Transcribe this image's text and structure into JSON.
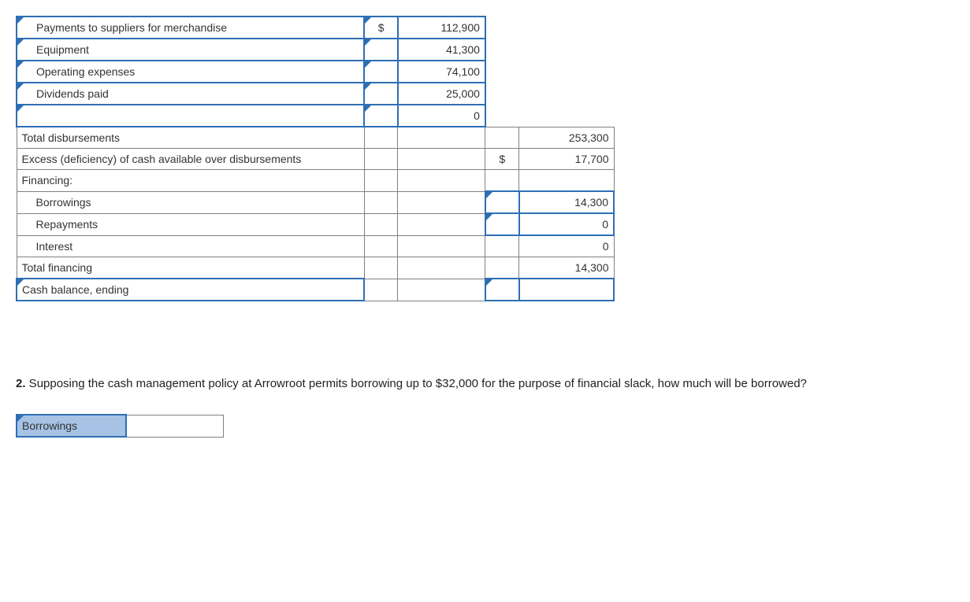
{
  "rows": {
    "payments_label": "Payments to suppliers for merchandise",
    "payments_sym": "$",
    "payments_val": "112,900",
    "equipment_label": "Equipment",
    "equipment_val": "41,300",
    "opex_label": "Operating expenses",
    "opex_val": "74,100",
    "dividends_label": "Dividends paid",
    "dividends_val": "25,000",
    "blank_val": "0",
    "total_disb_label": "Total disbursements",
    "total_disb_val": "253,300",
    "excess_label": "Excess (deficiency) of cash available over disbursements",
    "excess_sym": "$",
    "excess_val": "17,700",
    "financing_label": "Financing:",
    "borrowings_label": "Borrowings",
    "borrowings_val": "14,300",
    "repayments_label": "Repayments",
    "repayments_val": "0",
    "interest_label": "Interest",
    "interest_val": "0",
    "total_fin_label": "Total financing",
    "total_fin_val": "14,300",
    "ending_label": "Cash balance, ending"
  },
  "question": {
    "num": "2.",
    "text": " Supposing the cash management policy at Arrowroot permits borrowing up to $32,000 for the purpose of financial slack, how much will be borrowed?"
  },
  "answer": {
    "label": "Borrowings",
    "value": ""
  }
}
